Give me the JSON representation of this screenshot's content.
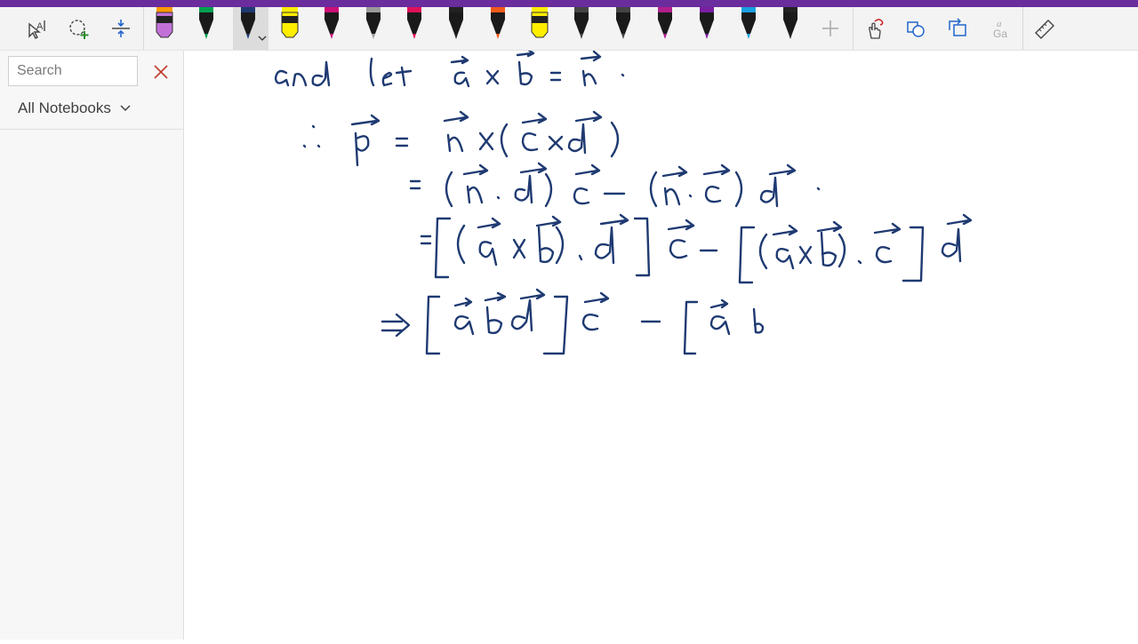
{
  "app": {
    "accent_color": "#6b2c9e",
    "ink_color": "#1f3a72"
  },
  "toolbar": {
    "tools": [
      {
        "name": "lasso-select",
        "icon": "lasso-text-select-icon"
      },
      {
        "name": "add-shape-select",
        "icon": "lasso-add-icon"
      },
      {
        "name": "add-space",
        "icon": "insert-space-icon"
      }
    ],
    "pens": [
      {
        "kind": "highlighter",
        "color": "#c271d9",
        "cap": "#ff9900"
      },
      {
        "kind": "pen",
        "color": "#00a050"
      },
      {
        "kind": "pen",
        "color": "#1f3a72",
        "selected": true
      },
      {
        "kind": "highlighter",
        "color": "#ffee00"
      },
      {
        "kind": "pen",
        "color": "#cc1177"
      },
      {
        "kind": "pen",
        "color": "#9a9a9a"
      },
      {
        "kind": "pen",
        "color": "#e0105a"
      },
      {
        "kind": "pen",
        "color": "#222222"
      },
      {
        "kind": "pen",
        "color": "#f05a1a"
      },
      {
        "kind": "highlighter",
        "color": "#ffee00"
      },
      {
        "kind": "pen",
        "color": "#444444"
      },
      {
        "kind": "pen",
        "color": "#444444"
      },
      {
        "kind": "pen",
        "color": "#b01e8c"
      },
      {
        "kind": "pen",
        "color": "#7a1fa2"
      },
      {
        "kind": "pen",
        "color": "#18a0e0"
      },
      {
        "kind": "pen",
        "color": "#222222"
      }
    ],
    "right_tools": [
      {
        "name": "add-pen",
        "icon": "plus-icon"
      },
      {
        "name": "touch-drawing",
        "icon": "touch-draw-icon"
      },
      {
        "name": "ink-to-shape",
        "icon": "ink-to-shape-icon"
      },
      {
        "name": "replay",
        "icon": "ink-replay-icon"
      },
      {
        "name": "ink-to-text",
        "icon": "ink-to-text-icon"
      },
      {
        "name": "ruler",
        "icon": "ruler-icon"
      }
    ]
  },
  "sidebar": {
    "search": {
      "placeholder": "Search",
      "value": ""
    },
    "notebook_filter": "All Notebooks"
  },
  "canvas": {
    "content": "handwritten-vector-triple-product-derivation"
  }
}
